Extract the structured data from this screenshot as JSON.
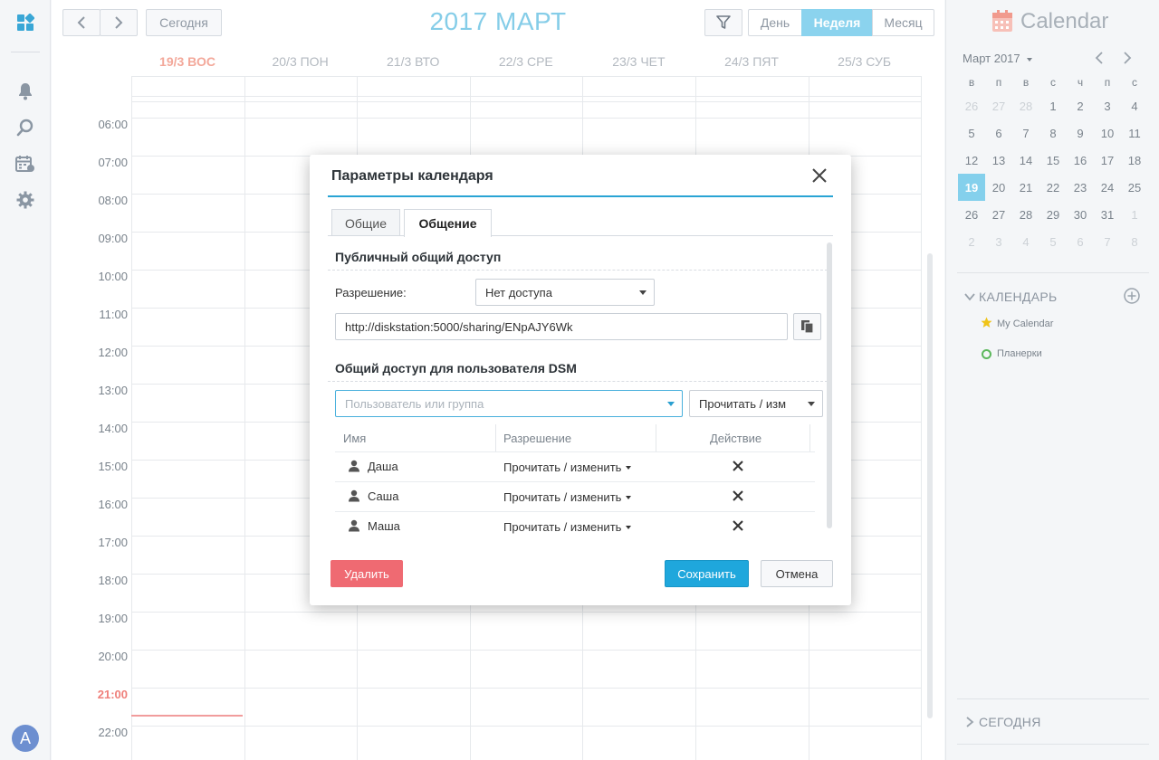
{
  "toolbar": {
    "today_label": "Сегодня",
    "month_title": "2017 МАРТ",
    "views": [
      "День",
      "Неделя",
      "Месяц"
    ],
    "active_view": "Неделя"
  },
  "week": {
    "days": [
      "19/3 ВОС",
      "20/3 ПОН",
      "21/3 ВТО",
      "22/3 СРЕ",
      "23/3 ЧЕТ",
      "24/3 ПЯТ",
      "25/3 СУБ"
    ],
    "today_index": 0,
    "hours": [
      "06:00",
      "07:00",
      "08:00",
      "09:00",
      "10:00",
      "11:00",
      "12:00",
      "13:00",
      "14:00",
      "15:00",
      "16:00",
      "17:00",
      "18:00",
      "19:00",
      "20:00",
      "21:00",
      "22:00"
    ],
    "current_hour": "21:00"
  },
  "sidebar": {
    "title": "Calendar",
    "mini_month": "Март 2017",
    "weekdays": [
      "в",
      "п",
      "в",
      "с",
      "ч",
      "п",
      "с"
    ],
    "weeks": [
      [
        "26",
        "27",
        "28",
        "1",
        "2",
        "3",
        "4"
      ],
      [
        "5",
        "6",
        "7",
        "8",
        "9",
        "10",
        "11"
      ],
      [
        "12",
        "13",
        "14",
        "15",
        "16",
        "17",
        "18"
      ],
      [
        "19",
        "20",
        "21",
        "22",
        "23",
        "24",
        "25"
      ],
      [
        "26",
        "27",
        "28",
        "29",
        "30",
        "31",
        "1"
      ],
      [
        "2",
        "3",
        "4",
        "5",
        "6",
        "7",
        "8"
      ]
    ],
    "selected_day": "19",
    "calendars_header": "КАЛЕНДАРЬ",
    "calendars": [
      {
        "name": "My Calendar",
        "icon": "star-icon",
        "color": "#f0c419"
      },
      {
        "name": "Планерки",
        "icon": "circle-icon",
        "color": "#5cb85c"
      }
    ],
    "today_header": "СЕГОДНЯ"
  },
  "user": {
    "avatar_letter": "A"
  },
  "modal": {
    "title": "Параметры календаря",
    "tabs": [
      "Общие",
      "Общение"
    ],
    "active_tab": "Общение",
    "public_title": "Публичный общий доступ",
    "permission_label": "Разрешение:",
    "permission_value": "Нет доступа",
    "share_url": "http://diskstation:5000/sharing/ENpAJY6Wk",
    "dsm_title": "Общий доступ для пользователя DSM",
    "user_placeholder": "Пользователь или группа",
    "new_permission": "Прочитать / изм",
    "table": {
      "headers": [
        "Имя",
        "Разрешение",
        "Действие"
      ],
      "rows": [
        {
          "name": "Даша",
          "permission": "Прочитать / изменить"
        },
        {
          "name": "Саша",
          "permission": "Прочитать / изменить"
        },
        {
          "name": "Маша",
          "permission": "Прочитать / изменить"
        }
      ]
    },
    "delete_label": "Удалить",
    "save_label": "Сохранить",
    "cancel_label": "Отмена"
  },
  "colors": {
    "accent": "#1fa7dc",
    "today": "#f3a89a",
    "danger": "#ef6a72"
  }
}
